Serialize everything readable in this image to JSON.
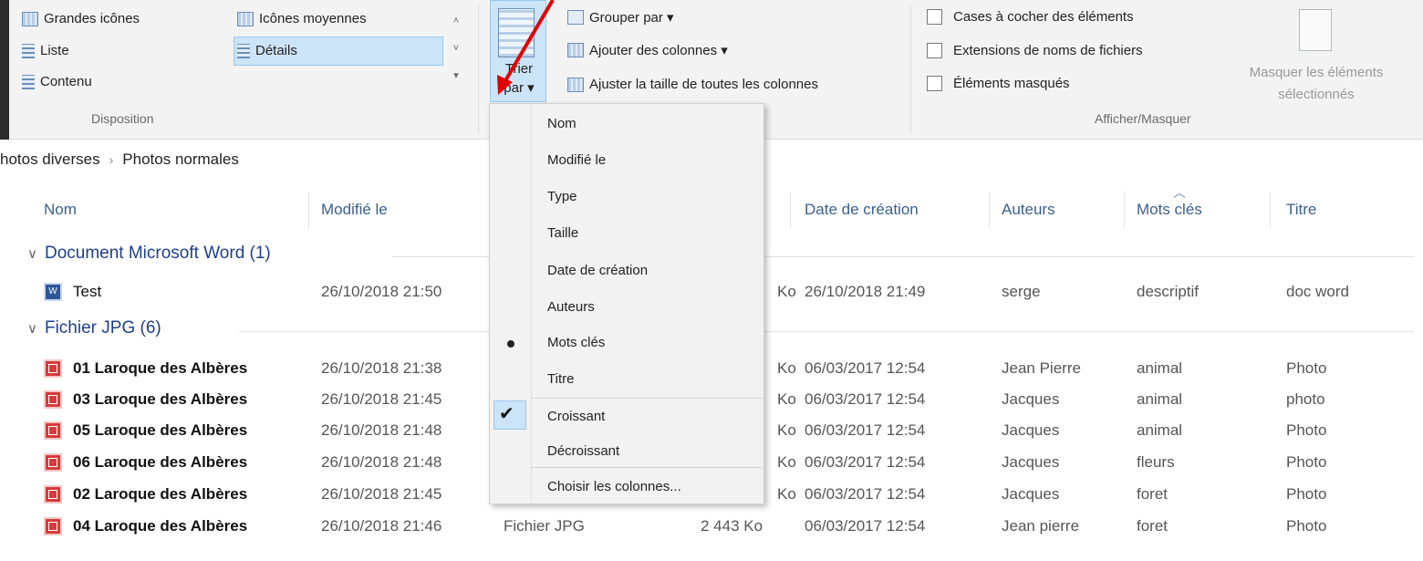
{
  "ribbon": {
    "disposition": {
      "items": [
        "Grandes icônes",
        "Icônes moyennes",
        "Liste",
        "Détails",
        "Contenu"
      ],
      "group_label": "Disposition"
    },
    "trier": {
      "line1": "Trier",
      "line2": "par ▾"
    },
    "affichage": {
      "grouper": "Grouper par ▾",
      "ajouter": "Ajouter des colonnes ▾",
      "ajuster": "Ajuster la taille de toutes les colonnes"
    },
    "afficher_masquer": {
      "checkboxes": [
        "Cases à cocher des éléments",
        "Extensions de noms de fichiers",
        "Éléments masqués"
      ],
      "masquer_line1": "Masquer les éléments",
      "masquer_line2": "sélectionnés",
      "group_label": "Afficher/Masquer"
    }
  },
  "breadcrumb": {
    "part1": "hotos diverses",
    "sep": "›",
    "part2": "Photos normales"
  },
  "columns": [
    "Nom",
    "Modifié le",
    "Date de création",
    "Auteurs",
    "Mots clés",
    "Titre"
  ],
  "groups": [
    {
      "label": "Document Microsoft Word (1)"
    },
    {
      "label": "Fichier JPG (6)"
    }
  ],
  "rows": [
    {
      "name": "Test",
      "modified": "26/10/2018 21:50",
      "type": "",
      "size": "Ko",
      "created": "26/10/2018 21:49",
      "author": "serge",
      "keywords": "descriptif",
      "title": "doc word"
    },
    {
      "name": "01 Laroque des Albères",
      "modified": "26/10/2018 21:38",
      "type": "",
      "size": "Ko",
      "created": "06/03/2017 12:54",
      "author": "Jean Pierre",
      "keywords": "animal",
      "title": "Photo"
    },
    {
      "name": "03 Laroque des Albères",
      "modified": "26/10/2018 21:45",
      "type": "",
      "size": "Ko",
      "created": "06/03/2017 12:54",
      "author": "Jacques",
      "keywords": "animal",
      "title": "photo"
    },
    {
      "name": "05 Laroque des Albères",
      "modified": "26/10/2018 21:48",
      "type": "",
      "size": "Ko",
      "created": "06/03/2017 12:54",
      "author": "Jacques",
      "keywords": "animal",
      "title": "Photo"
    },
    {
      "name": "06 Laroque des Albères",
      "modified": "26/10/2018 21:48",
      "type": "",
      "size": "Ko",
      "created": "06/03/2017 12:54",
      "author": "Jacques",
      "keywords": "fleurs",
      "title": "Photo"
    },
    {
      "name": "02 Laroque des Albères",
      "modified": "26/10/2018 21:45",
      "type": "",
      "size": "Ko",
      "created": "06/03/2017 12:54",
      "author": "Jacques",
      "keywords": "foret",
      "title": "Photo"
    },
    {
      "name": "04 Laroque des Albères",
      "modified": "26/10/2018 21:46",
      "type": "Fichier JPG",
      "size": "2 443 Ko",
      "created": "06/03/2017 12:54",
      "author": "Jean pierre",
      "keywords": "foret",
      "title": "Photo"
    }
  ],
  "sort_menu": {
    "fields": [
      "Nom",
      "Modifié le",
      "Type",
      "Taille",
      "Date de création",
      "Auteurs",
      "Mots clés",
      "Titre"
    ],
    "selected_field": "Mots clés",
    "order": [
      "Croissant",
      "Décroissant"
    ],
    "selected_order": "Croissant",
    "choose": "Choisir les colonnes..."
  },
  "colors": {
    "accent": "#cce4f7",
    "group_header": "#1e3f8a",
    "arrow": "#e00000"
  }
}
